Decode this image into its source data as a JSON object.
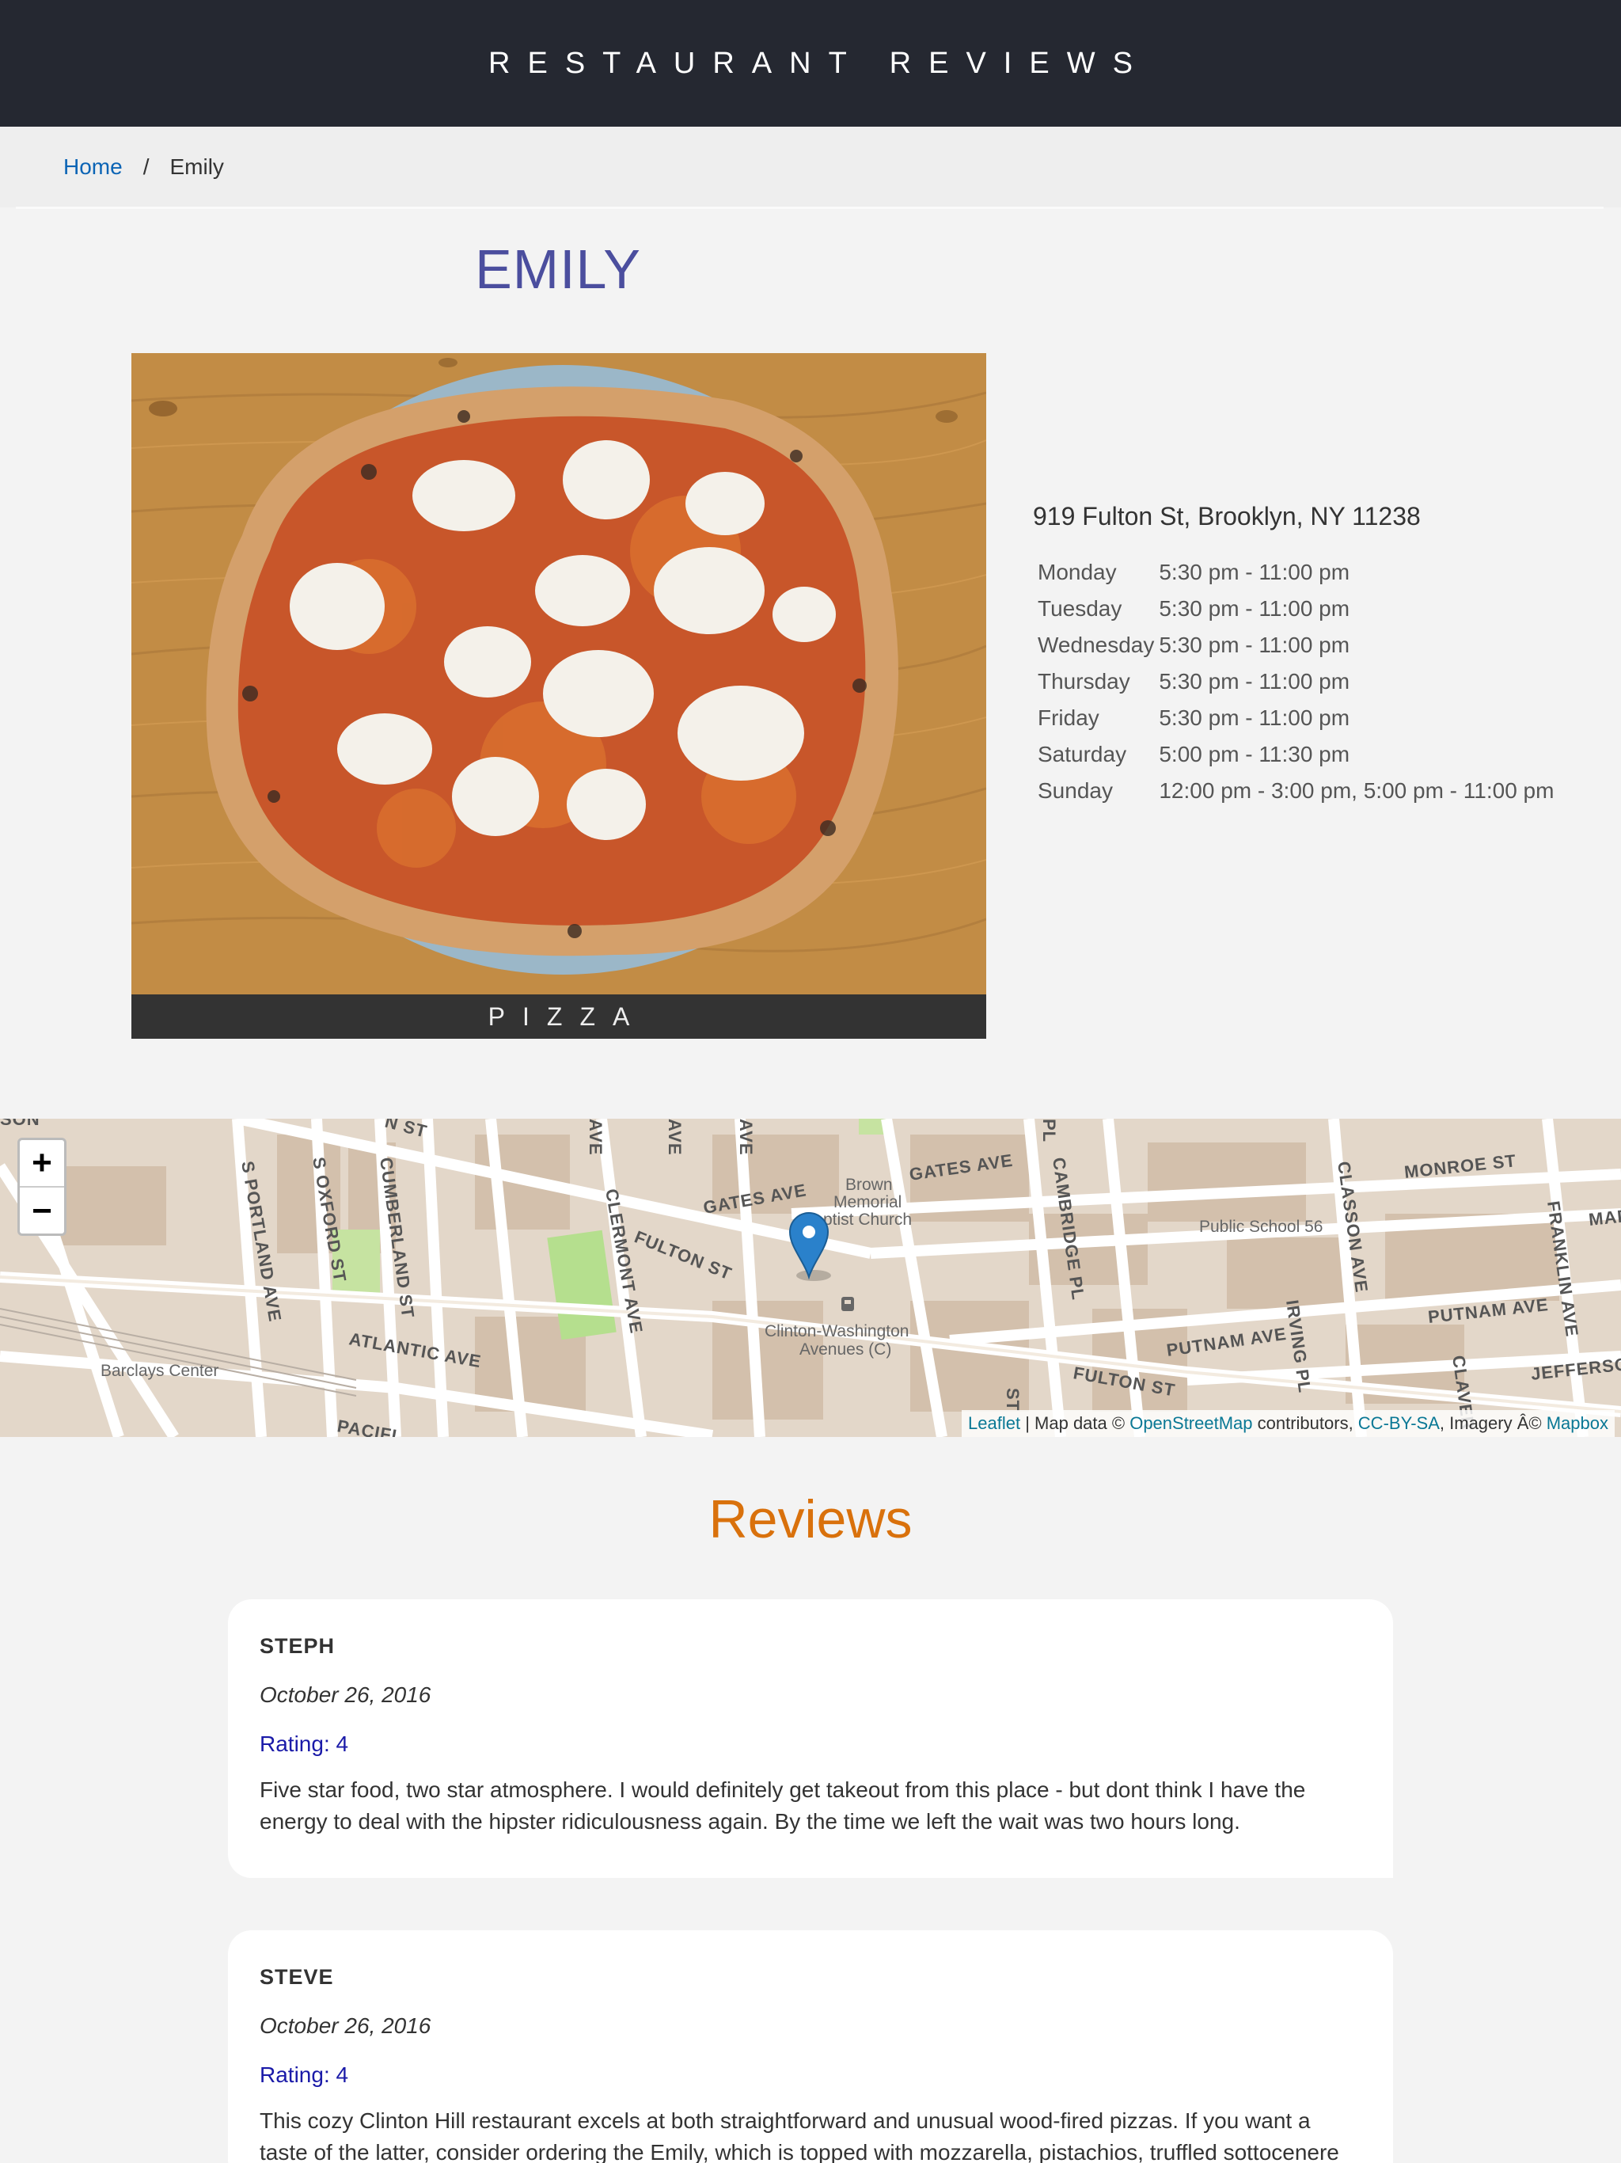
{
  "header": {
    "title": "RESTAURANT REVIEWS"
  },
  "breadcrumb": {
    "home": "Home",
    "separator": "/",
    "current": "Emily"
  },
  "restaurant": {
    "name": "EMILY",
    "photo_alt": "Emily",
    "cuisine": "PIZZA",
    "address": "919 Fulton St, Brooklyn, NY 11238",
    "hours": [
      {
        "day": "Monday",
        "time": "5:30 pm - 11:00 pm"
      },
      {
        "day": "Tuesday",
        "time": "5:30 pm - 11:00 pm"
      },
      {
        "day": "Wednesday",
        "time": "5:30 pm - 11:00 pm"
      },
      {
        "day": "Thursday",
        "time": "5:30 pm - 11:00 pm"
      },
      {
        "day": "Friday",
        "time": "5:30 pm - 11:00 pm"
      },
      {
        "day": "Saturday",
        "time": "5:00 pm - 11:30 pm"
      },
      {
        "day": "Sunday",
        "time": "12:00 pm - 3:00 pm, 5:00 pm - 11:00 pm"
      }
    ]
  },
  "map": {
    "zoom_in": "+",
    "zoom_out": "−",
    "labels": {
      "gates_ave": "GATES AVE",
      "gates_ave_2": "GATES AVE",
      "fulton_st": "FULTON ST",
      "fulton_st_2": "FULTON ST",
      "atlantic_ave": "ATLANTIC AVE",
      "s_portland": "S PORTLAND AVE",
      "s_oxford": "S OXFORD ST",
      "cumberland": "CUMBERLAND ST",
      "clermont": "CLERMONT AVE",
      "cambridge": "CAMBRIDGE PL",
      "classon": "CLASSON AVE",
      "irving": "IRVING PL",
      "putnam": "PUTNAM AVE",
      "putnam_2": "PUTNAM AVE",
      "monroe": "MONROE ST",
      "franklin": "FRANKLIN AVE",
      "jefferson": "JEFFERSON",
      "madison": "MADIS",
      "claver": "CLAVER",
      "barclays": "Barclays Center",
      "church_1": "Brown",
      "church_2": "Memorial",
      "church_3": "ptist Church",
      "school": "Public School 56",
      "station_1": "Clinton-Washington",
      "station_2": "Avenues (C)",
      "pacific": "PACIFI",
      "ave_1": "AVE",
      "ave_2": "AVE",
      "ave_3": "AVE",
      "st_1": "N ST",
      "son": "SON",
      "pl": "PL",
      "st_2": "ST"
    },
    "attribution": {
      "leaflet": "Leaflet",
      "sep": " | Map data © ",
      "osm": "OpenStreetMap",
      "contributors": " contributors, ",
      "license": "CC-BY-SA",
      "imagery": ", Imagery Â© ",
      "mapbox": "Mapbox"
    }
  },
  "reviews": {
    "title": "Reviews",
    "items": [
      {
        "name": "STEPH",
        "date": "October 26, 2016",
        "rating": "Rating: 4",
        "comments": "Five star food, two star atmosphere. I would definitely get takeout from this place - but dont think I have the energy to deal with the hipster ridiculousness again. By the time we left the wait was two hours long."
      },
      {
        "name": "STEVE",
        "date": "October 26, 2016",
        "rating": "Rating: 4",
        "comments": "This cozy Clinton Hill restaurant excels at both straightforward and unusual wood-fired pizzas. If you want a taste of the latter, consider ordering the Emily, which is topped with mozzarella, pistachios, truffled sottocenere cheese, and"
      }
    ]
  },
  "colors": {
    "header_bg": "#252831",
    "link": "#0b64b5",
    "restaurant_name": "#4b4e9e",
    "reviews_title": "#d9710c",
    "rating": "#1a1aa8",
    "marker": "#2a81cb"
  }
}
